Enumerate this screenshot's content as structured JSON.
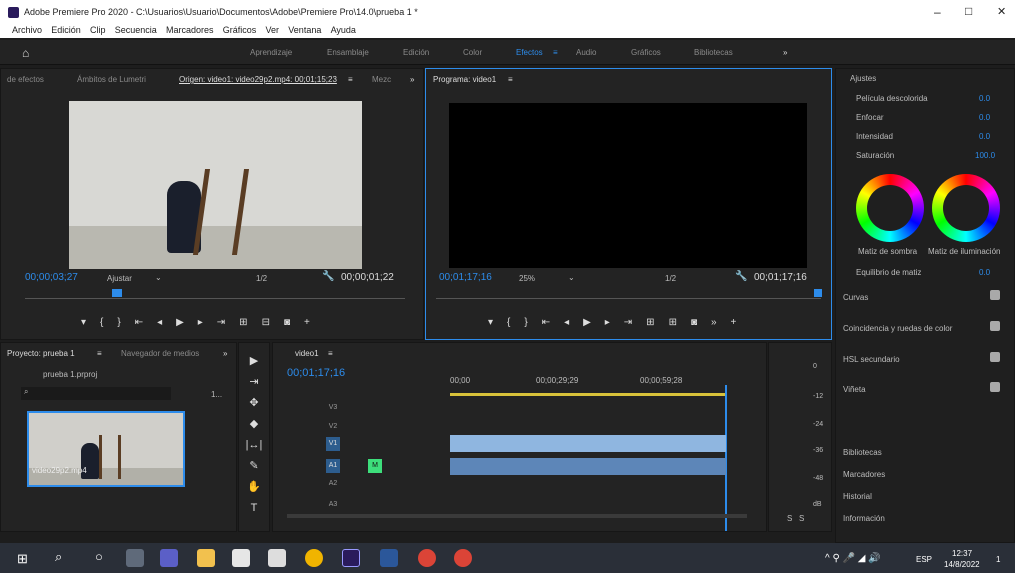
{
  "window": {
    "title": "Adobe Premiere Pro 2020 - C:\\Usuarios\\Usuario\\Documentos\\Adobe\\Premiere Pro\\14.0\\prueba 1 *",
    "min": "–",
    "max": "□",
    "close": "✕"
  },
  "menu": [
    "Archivo",
    "Edición",
    "Clip",
    "Secuencia",
    "Marcadores",
    "Gráficos",
    "Ver",
    "Ventana",
    "Ayuda"
  ],
  "workspaces": [
    "Aprendizaje",
    "Ensamblaje",
    "Edición",
    "Color",
    "Efectos",
    "Audio",
    "Gráficos",
    "Bibliotecas"
  ],
  "workspace_more": "»",
  "source": {
    "tabs": [
      "de efectos",
      "Ámbitos de Lumetri",
      "Origen: video1: video29p2.mp4: 00;01;15;23",
      "Mezc"
    ],
    "tab_menu": "≡",
    "tab_more": "»",
    "timecode": "00;00;03;27",
    "fit": "Ajustar",
    "resolution": "1/2",
    "duration": "00;00;01;22"
  },
  "program": {
    "tab": "Programa: video1",
    "tab_menu": "≡",
    "timecode": "00;01;17;16",
    "zoom": "25%",
    "resolution": "1/2",
    "duration": "00;01;17;16"
  },
  "lumetri": {
    "section": "Ajustes",
    "rows": [
      {
        "label": "Película descolorida",
        "value": "0.0"
      },
      {
        "label": "Enfocar",
        "value": "0.0"
      },
      {
        "label": "Intensidad",
        "value": "0.0"
      },
      {
        "label": "Saturación",
        "value": "100.0"
      }
    ],
    "wheel1": "Matiz de sombra",
    "wheel2": "Matiz de iluminación",
    "balance_label": "Equilibrio de matiz",
    "balance_value": "0.0",
    "sections": [
      "Curvas",
      "Coincidencia y ruedas de color",
      "HSL secundario",
      "Viñeta"
    ]
  },
  "side_panels": [
    "Bibliotecas",
    "Marcadores",
    "Historial",
    "Información"
  ],
  "project": {
    "tab": "Proyecto: prueba 1",
    "tab_menu": "≡",
    "tab2": "Navegador de medios",
    "tab_more": "»",
    "file": "prueba 1.prproj",
    "clip": "video29p2.mp4",
    "count": "1..."
  },
  "timeline": {
    "tab": "video1",
    "tab_menu": "≡",
    "timecode": "00;01;17;16",
    "ruler": [
      "00;00",
      "00;00;29;29",
      "00;00;59;28"
    ],
    "tracks": [
      "V3",
      "V2",
      "V1",
      "A1",
      "A2",
      "A3"
    ],
    "meter": [
      "0",
      "-12",
      "-24",
      "-36",
      "-48",
      "dB"
    ],
    "solo": [
      "S",
      "S"
    ]
  },
  "taskbar": {
    "time": "12:37",
    "date": "14/8/2022",
    "lang": "ESP",
    "badge": "1"
  },
  "colors": {
    "accent": "#2d8ceb",
    "premiere": "#2a1b5c",
    "green": "#3dde7b",
    "video_clip": "#8fb6e0",
    "audio_clip": "#5d86b8"
  }
}
